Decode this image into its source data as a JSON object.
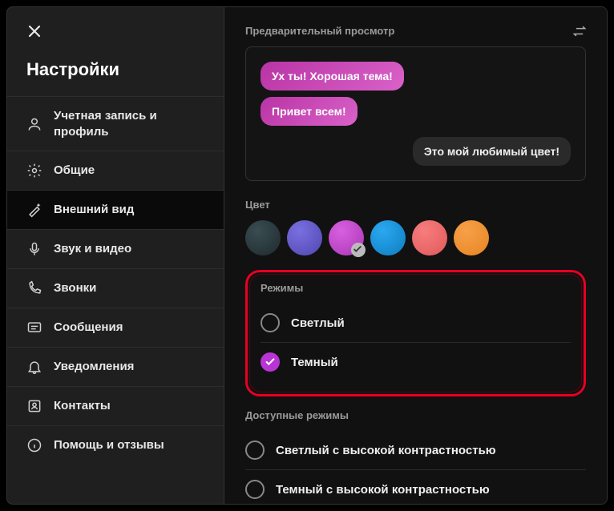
{
  "title": "Настройки",
  "sidebar": {
    "items": [
      {
        "label": "Учетная запись и профиль"
      },
      {
        "label": "Общие"
      },
      {
        "label": "Внешний вид"
      },
      {
        "label": "Звук и видео"
      },
      {
        "label": "Звонки"
      },
      {
        "label": "Сообщения"
      },
      {
        "label": "Уведомления"
      },
      {
        "label": "Контакты"
      },
      {
        "label": "Помощь и отзывы"
      }
    ],
    "activeIndex": 2
  },
  "preview": {
    "label": "Предварительный просмотр",
    "msg1": "Ух ты! Хорошая тема!",
    "msg2": "Привет всем!",
    "msg3": "Это мой любимый цвет!"
  },
  "color": {
    "label": "Цвет",
    "swatches": [
      "#2b3a3e",
      "#6a5ed1",
      "#c84fd0",
      "#1697e0",
      "#f26d6d",
      "#f09038"
    ],
    "selectedIndex": 2
  },
  "modes": {
    "label": "Режимы",
    "items": [
      {
        "label": "Светлый"
      },
      {
        "label": "Темный"
      }
    ],
    "selectedIndex": 1
  },
  "available": {
    "label": "Доступные режимы",
    "items": [
      {
        "label": "Светлый с высокой контрастностью"
      },
      {
        "label": "Темный с высокой контрастностью"
      }
    ]
  }
}
